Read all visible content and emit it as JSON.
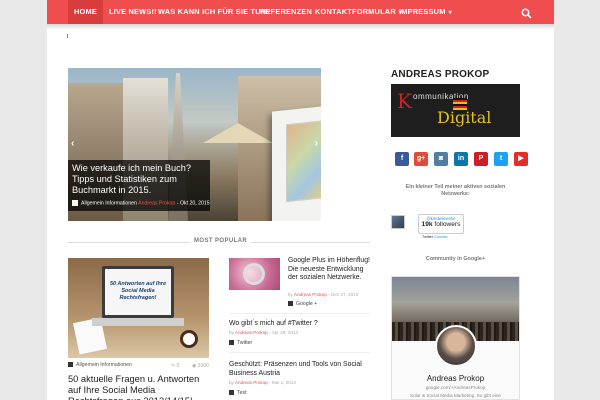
{
  "nav": {
    "items": [
      {
        "label": "HOME"
      },
      {
        "label": "LIVE NEWS!!"
      },
      {
        "label": "WAS KANN ICH FÜR SIE TUN?"
      },
      {
        "label": "REFERENZEN"
      },
      {
        "label": "KONTAKTFORMULAR"
      },
      {
        "label": "IMPRESSUM"
      }
    ],
    "search_icon": "search-icon"
  },
  "slider": {
    "title": "Wie verkaufe ich mein Buch? Tipps und Statistiken zum Buchmarkt in 2015.",
    "category": "Allgemein Informationen",
    "author": "Andreas Prokop",
    "date": "Okt 20, 2015",
    "prev_icon": "chevron-left-icon",
    "next_icon": "chevron-right-icon"
  },
  "most_popular": {
    "label": "MOST POPULAR",
    "featured": {
      "thumb_text": "50 Antworten auf Ihre Social Media Rechtsfragen!",
      "category": "Allgemein Informationen",
      "comments": "0",
      "views": "2300",
      "title": "50 aktuelle Fragen u. Antworten auf Ihre Social Media Rechtsfragen aus 2013/14/15!"
    },
    "list": [
      {
        "title": "Google Plus im Höhenflug! Die neueste Entwicklung der sozialen Netzwerke.",
        "by": "by",
        "author": "Andreas Prokop",
        "date": "Dez 27, 2013",
        "category": "Google +"
      },
      {
        "title": "Wo gibt´s mich auf #Twitter ?",
        "by": "by",
        "author": "Andreas Prokop",
        "date": "Apr 28, 2013",
        "category": "Twitter"
      },
      {
        "title": "Geschützt: Präsenzen und Tools von Social Business Austria",
        "by": "by",
        "author": "Andreas Prokop",
        "date": "Mai 1, 2014",
        "category": "Test"
      }
    ]
  },
  "sidebar": {
    "title": "ANDREAS PROKOP",
    "logo": {
      "top": "ommunikation",
      "k": "K",
      "d": "igital",
      "d_first": "D"
    },
    "social": [
      {
        "name": "facebook-icon",
        "glyph": "f",
        "color": "#3b5998"
      },
      {
        "name": "googleplus-icon",
        "glyph": "g+",
        "color": "#dd4b39"
      },
      {
        "name": "instagram-icon",
        "glyph": "◙",
        "color": "#517fa4"
      },
      {
        "name": "linkedin-icon",
        "glyph": "in",
        "color": "#0e76a8"
      },
      {
        "name": "pinterest-icon",
        "glyph": "P",
        "color": "#cb2027"
      },
      {
        "name": "twitter-icon",
        "glyph": "t",
        "color": "#1da1f2"
      },
      {
        "name": "youtube-icon",
        "glyph": "▶",
        "color": "#e52d27"
      }
    ],
    "networks_caption": "Ein kleiner Teil meiner aktiven sozialen Netzwerke:",
    "twitter_widget": {
      "handle": "@kmdwevetme",
      "count": "19k",
      "count_label": "followers",
      "footer_a": "Twitter",
      "footer_b": "Counter"
    },
    "gplus": {
      "caption": "Community in Google+",
      "name": "Andreas Prokop",
      "url": "google.com/+AndreasProkop",
      "tagline": "Solar & Social Media Marketing. So gibt eine"
    }
  }
}
